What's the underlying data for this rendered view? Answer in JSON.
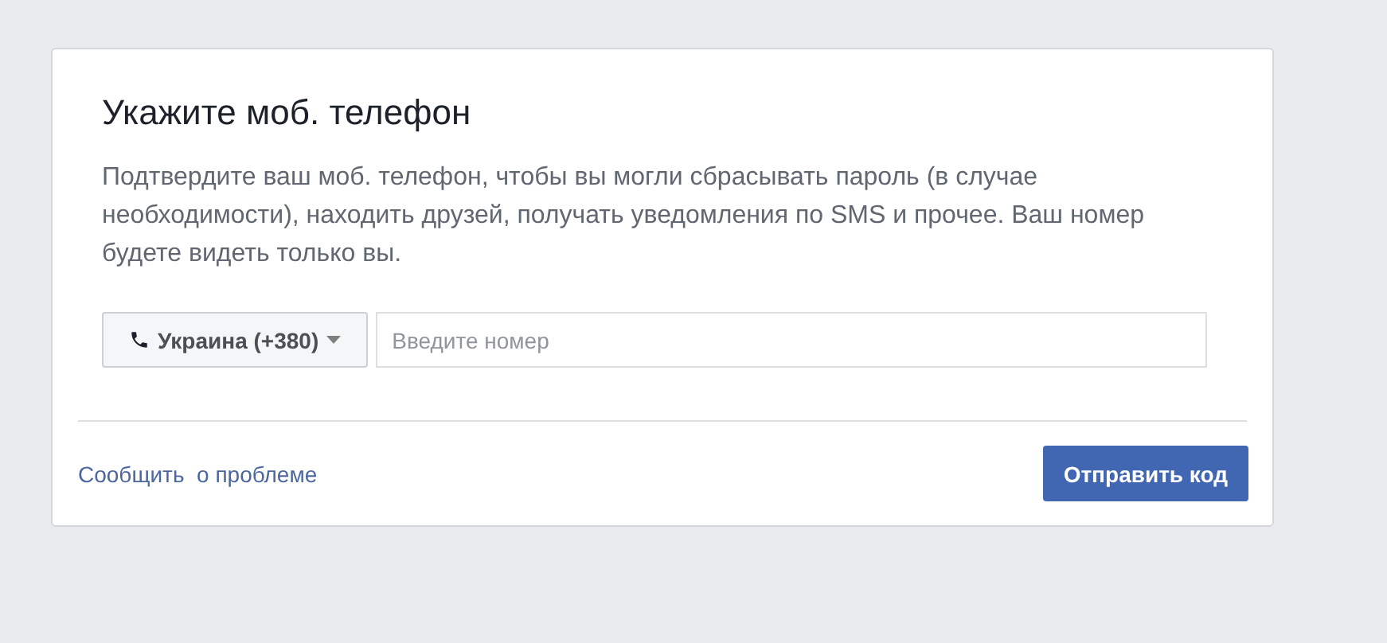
{
  "dialog": {
    "title": "Укажите моб. телефон",
    "description": "Подтвердите ваш моб. телефон, чтобы вы могли сбрасывать пароль (в случае необходимости), находить друзей, получать уведомления по SMS и прочее. Ваш номер будете видеть только вы.",
    "country_select": {
      "value": "Украина (+380)"
    },
    "phone_field": {
      "placeholder": "Введите номер"
    },
    "report_link": "Сообщить  о проблеме",
    "submit_button": "Отправить код"
  }
}
